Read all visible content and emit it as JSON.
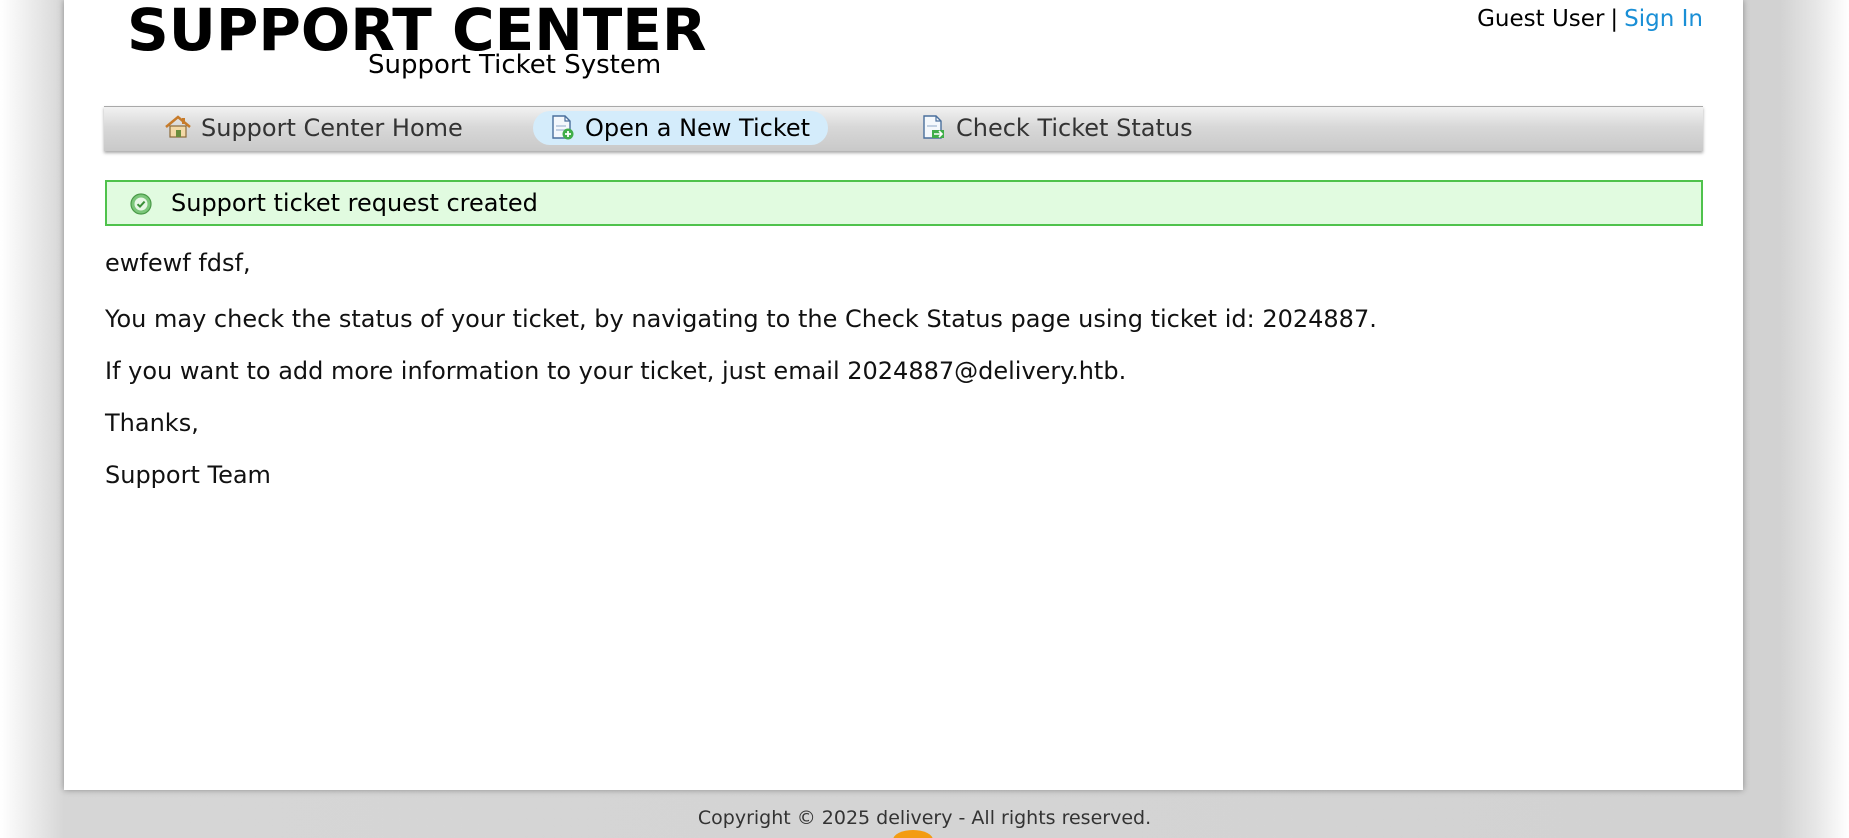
{
  "header": {
    "title": "SUPPORT CENTER",
    "subtitle": "Support Ticket System",
    "user_label": "Guest User",
    "separator": "|",
    "sign_in_label": "Sign In"
  },
  "nav": {
    "items": [
      {
        "label": "Support Center Home",
        "icon": "home-icon",
        "active": false
      },
      {
        "label": "Open a New Ticket",
        "icon": "new-ticket-icon",
        "active": true
      },
      {
        "label": "Check Ticket Status",
        "icon": "ticket-status-icon",
        "active": false
      }
    ]
  },
  "notice": {
    "icon": "check-circle-icon",
    "text": "Support ticket request created"
  },
  "message": {
    "greeting": "ewfewf fdsf,",
    "status_line": "You may check the status of your ticket, by navigating to the Check Status page using ticket id: 2024887.",
    "email_line": "If you want to add more information to your ticket, just email 2024887@delivery.htb.",
    "thanks": "Thanks,",
    "signoff": "Support Team"
  },
  "footer": {
    "copyright": "Copyright © 2025 delivery - All rights reserved."
  },
  "colors": {
    "link": "#1a8fd6",
    "notice_bg": "#e1fbe0",
    "notice_border": "#4fc24c",
    "active_tab_bg": "#d4ecfb"
  }
}
